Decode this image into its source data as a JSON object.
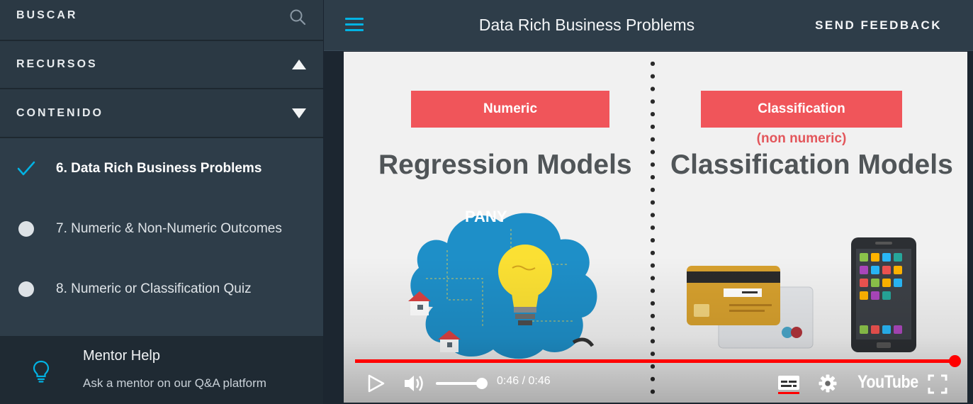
{
  "sidebar": {
    "search_label": "BUSCAR",
    "recursos_label": "RECURSOS",
    "contenido_label": "CONTENIDO",
    "lessons": [
      {
        "label": "6. Data Rich Business Problems",
        "state": "completed-current"
      },
      {
        "label": "7. Numeric & Non-Numeric Outcomes",
        "state": "not-started"
      },
      {
        "label": "8. Numeric or Classification Quiz",
        "state": "not-started"
      }
    ],
    "mentor": {
      "title": "Mentor Help",
      "subtitle": "Ask a mentor on our Q&A platform"
    }
  },
  "header": {
    "title": "Data Rich Business Problems",
    "feedback_label": "SEND FEEDBACK"
  },
  "video": {
    "left_tag": "Numeric",
    "left_heading": "Regression Models",
    "cloud_text": "PANY",
    "right_tag": "Classification",
    "right_subtag": "(non numeric)",
    "right_heading": "Classification Models",
    "time_display": "0:46 / 0:46",
    "progress_fraction": 1.0,
    "volume_fraction": 1.0,
    "player_brand": "YouTube"
  },
  "colors": {
    "accent": "#02b3e4",
    "tag_red": "#f0555a",
    "progress_red": "#ff0000",
    "sidebar_bg": "#2e3d49"
  }
}
